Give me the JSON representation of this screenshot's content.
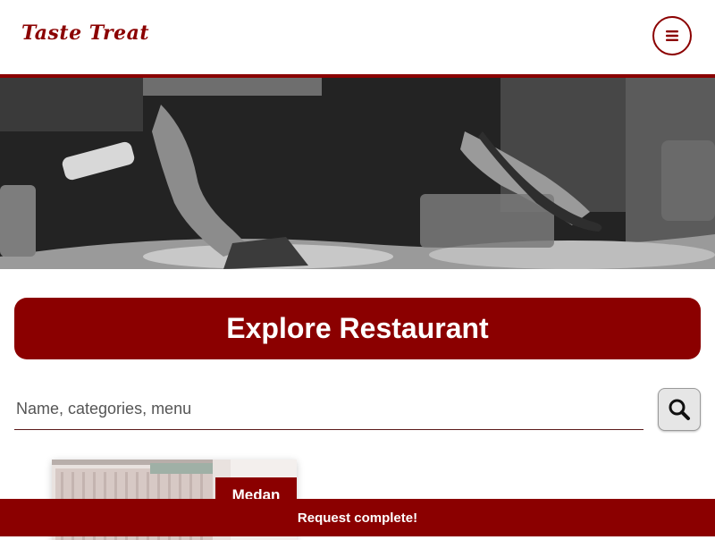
{
  "header": {
    "logo_text": "Taste Treat",
    "menu_icon": "hamburger-icon"
  },
  "hero": {
    "image_alt": ""
  },
  "main": {
    "title": "Explore Restaurant",
    "search": {
      "placeholder": "Name, categories, menu",
      "value": "",
      "button_icon": "search-icon"
    },
    "restaurants": [
      {
        "city": "Medan"
      }
    ]
  },
  "toast": {
    "message": "Request complete!"
  },
  "colors": {
    "brand": "#8b0000",
    "background": "#ffffff",
    "search_button_bg": "#e6e6e6"
  }
}
